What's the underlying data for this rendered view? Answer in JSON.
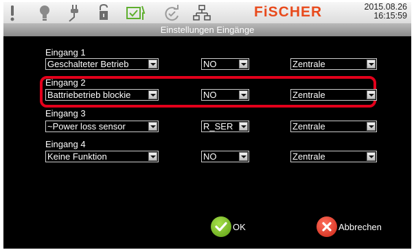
{
  "header": {
    "brand": "FiSCHER",
    "date": "2015.08.26",
    "time": "16:15:59",
    "subtitle": "Einstellungen Eingänge",
    "icons": [
      "alert-icon",
      "lightbulb-icon",
      "plug-icon",
      "battery-icon",
      "battery-charging-icon",
      "refresh-icon",
      "network-icon"
    ]
  },
  "inputs": [
    {
      "label": "Eingang 1",
      "function": "Geschalteter Betrieb",
      "mode": "NO",
      "target": "Zentrale"
    },
    {
      "label": "Eingang 2",
      "function": "Battriebetrieb blockie",
      "mode": "NO",
      "target": "Zentrale"
    },
    {
      "label": "Eingang 3",
      "function": "~Power loss sensor",
      "mode": "R_SER",
      "target": "Zentrale"
    },
    {
      "label": "Eingang 4",
      "function": "Keine Funktion",
      "mode": "NO",
      "target": "Zentrale"
    }
  ],
  "buttons": {
    "ok": "OK",
    "cancel": "Abbrechen"
  },
  "colors": {
    "highlight": "#e3001b",
    "brand": "#e84a1c",
    "ok": "#7cc11f",
    "cancel": "#e8362a"
  }
}
